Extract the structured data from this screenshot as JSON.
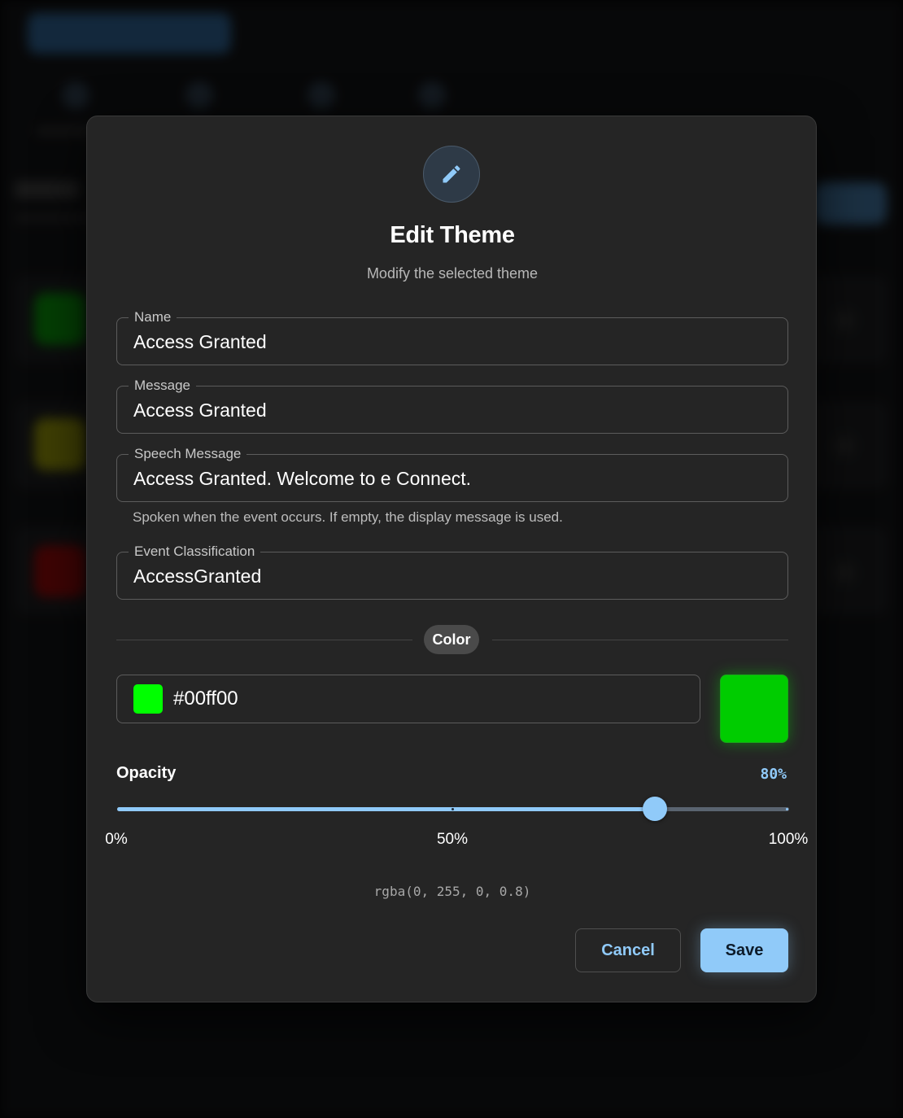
{
  "dialog": {
    "header_icon": "pencil-icon",
    "title": "Edit Theme",
    "subtitle": "Modify the selected theme"
  },
  "fields": {
    "name": {
      "label": "Name",
      "value": "Access Granted"
    },
    "message": {
      "label": "Message",
      "value": "Access Granted"
    },
    "speech_message": {
      "label": "Speech Message",
      "value": "Access Granted. Welcome to e Connect.",
      "helper": "Spoken when the event occurs. If empty, the display message is used."
    },
    "event_classification": {
      "label": "Event Classification",
      "value": "AccessGranted"
    }
  },
  "color_section": {
    "divider_label": "Color",
    "hex_value": "#00ff00",
    "swatch_color": "#00ff00",
    "preview_color": "#00cc00"
  },
  "opacity": {
    "label": "Opacity",
    "value_text": "80%",
    "value": 0.8,
    "ticks": [
      "0%",
      "50%",
      "100%"
    ],
    "rgba_text": "rgba(0, 255, 0, 0.8)"
  },
  "actions": {
    "cancel_label": "Cancel",
    "save_label": "Save"
  },
  "background": {
    "theme_swatch_colors": [
      "#0a8a0a",
      "#8a8a0a",
      "#8a0a0a"
    ]
  },
  "colors": {
    "accent": "#90caf9",
    "dialog_bg": "#252525"
  }
}
